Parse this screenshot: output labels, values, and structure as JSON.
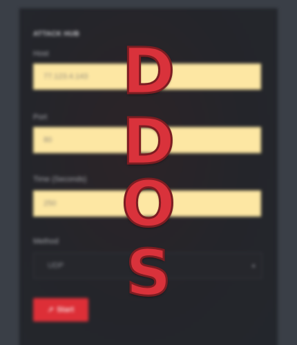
{
  "panel": {
    "title": "ATTACK HUB",
    "host": {
      "label": "Host",
      "value": "77.123.4.143"
    },
    "port": {
      "label": "Port",
      "value": "80"
    },
    "time": {
      "label": "Time (Seconds)",
      "value": "250"
    },
    "method": {
      "label": "Method",
      "value": "UDP"
    },
    "start_label": "Start"
  },
  "overlay": {
    "letters": [
      "D",
      "D",
      "O",
      "S"
    ],
    "color": "#d9323b"
  },
  "colors": {
    "input_bg": "#fde7a3",
    "button_bg": "#dd2f37",
    "panel_bg": "#24252a"
  },
  "icons": {
    "start": "rocket-icon",
    "select": "chevron-down-icon"
  }
}
